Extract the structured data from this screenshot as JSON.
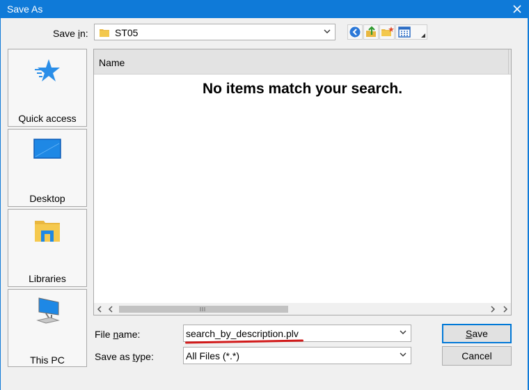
{
  "window": {
    "title": "Save As"
  },
  "save_in": {
    "label": "Save in:",
    "value": "ST05"
  },
  "places": [
    {
      "label": "Quick access",
      "icon": "star-icon"
    },
    {
      "label": "Desktop",
      "icon": "desktop-icon"
    },
    {
      "label": "Libraries",
      "icon": "libraries-icon"
    },
    {
      "label": "This PC",
      "icon": "computer-icon"
    }
  ],
  "file_list": {
    "column_name": "Name",
    "empty_message": "No items match your search."
  },
  "file_name": {
    "label": "File name:",
    "value": "search_by_description.plv"
  },
  "save_as_type": {
    "label": "Save as type:",
    "value": "All Files (*.*)"
  },
  "buttons": {
    "save": "Save",
    "cancel": "Cancel"
  },
  "colors": {
    "titlebar": "#0f7ad8",
    "annotation_underline": "#d11a1a"
  }
}
